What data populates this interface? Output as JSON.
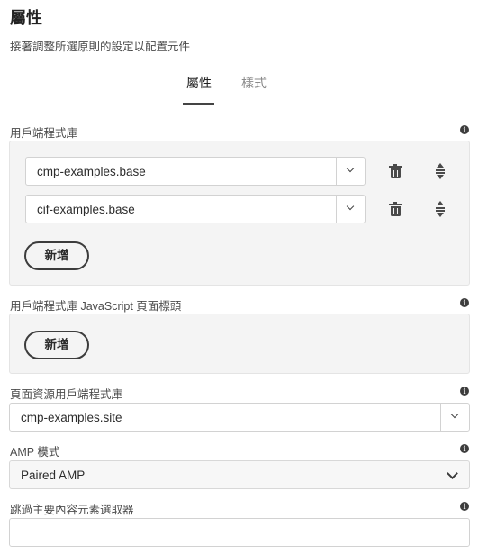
{
  "dialog": {
    "title": "屬性",
    "subtitle": "接著調整所選原則的設定以配置元件"
  },
  "tabs": [
    {
      "label": "屬性",
      "active": true
    },
    {
      "label": "樣式",
      "active": false
    }
  ],
  "client_libraries": {
    "label": "用戶端程式庫",
    "items": [
      {
        "value": "cmp-examples.base"
      },
      {
        "value": "cif-examples.base"
      }
    ],
    "add_label": "新增"
  },
  "js_head_libraries": {
    "label": "用戶端程式庫 JavaScript 頁面標頭",
    "add_label": "新增"
  },
  "page_resource_library": {
    "label": "頁面資源用戶端程式庫",
    "value": "cmp-examples.site"
  },
  "amp_mode": {
    "label": "AMP 模式",
    "value": "Paired AMP"
  },
  "skip_main_selector": {
    "label": "跳過主要內容元素選取器",
    "value": ""
  },
  "icons": {
    "info": "info-icon",
    "delete": "trash-icon",
    "reorder": "move-icon",
    "dropdown": "chevron-down-icon"
  },
  "colors": {
    "panel_bg": "#f4f4f4",
    "text": "#2c2c2c",
    "muted": "#8a8a8a"
  }
}
